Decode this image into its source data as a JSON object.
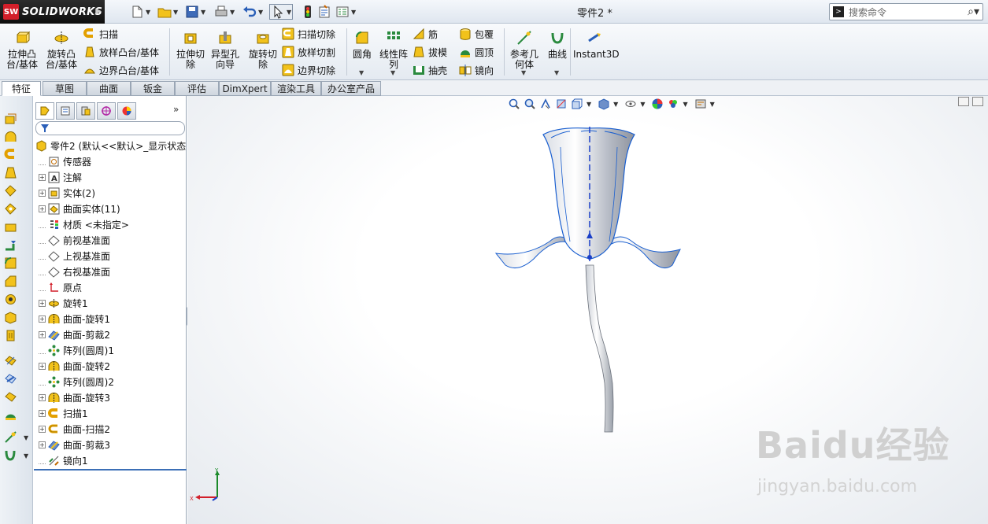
{
  "app": {
    "logo_text": "SOLIDWORKS",
    "logo_mark": "SW",
    "document_title": "零件2 *"
  },
  "search": {
    "placeholder": "搜索命令",
    "icon": "magnifier-icon"
  },
  "quick_access": [
    {
      "name": "new-icon"
    },
    {
      "name": "open-icon"
    },
    {
      "name": "save-icon"
    },
    {
      "name": "print-icon"
    },
    {
      "name": "undo-icon"
    },
    {
      "name": "select-icon"
    },
    {
      "name": "rebuild-icon"
    },
    {
      "name": "file-properties-icon"
    },
    {
      "name": "options-icon"
    }
  ],
  "command_manager": {
    "extrude_boss": "拉伸凸\n台/基体",
    "revolve_boss": "旋转凸\n台/基体",
    "sweep": "扫描",
    "loft_boss": "放样凸台/基体",
    "boundary_boss": "边界凸台/基体",
    "extrude_cut": "拉伸切\n除",
    "hole_wizard": "异型孔\n向导",
    "revolve_cut": "旋转切\n除",
    "swept_cut": "扫描切除",
    "lofted_cut": "放样切割",
    "boundary_cut": "边界切除",
    "fillet": "圆角",
    "linear_pattern": "线性阵\n列",
    "rib": "筋",
    "draft": "拔模",
    "shell": "抽壳",
    "wrap": "包覆",
    "dome": "圆顶",
    "mirror": "镜向",
    "ref_geometry": "参考几\n何体",
    "curves": "曲线",
    "instant3d": "Instant3D"
  },
  "tabs": [
    "特征",
    "草图",
    "曲面",
    "钣金",
    "评估",
    "DimXpert",
    "渲染工具",
    "办公室产品"
  ],
  "active_tab": "特征",
  "feature_tree": {
    "expand_glyph": "»",
    "root": "零件2  (默认<<默认>_显示状态",
    "items": [
      {
        "label": "传感器",
        "expandable": false,
        "icon": "sensor-icon"
      },
      {
        "label": "注解",
        "expandable": true,
        "icon": "annotation-icon"
      },
      {
        "label": "实体(2)",
        "expandable": true,
        "icon": "solid-bodies-icon"
      },
      {
        "label": "曲面实体(11)",
        "expandable": true,
        "icon": "surface-bodies-icon"
      },
      {
        "label": "材质 <未指定>",
        "expandable": false,
        "icon": "material-icon"
      },
      {
        "label": "前视基准面",
        "expandable": false,
        "icon": "plane-icon"
      },
      {
        "label": "上视基准面",
        "expandable": false,
        "icon": "plane-icon"
      },
      {
        "label": "右视基准面",
        "expandable": false,
        "icon": "plane-icon"
      },
      {
        "label": "原点",
        "expandable": false,
        "icon": "origin-icon"
      },
      {
        "label": "旋转1",
        "expandable": true,
        "icon": "revolve-icon"
      },
      {
        "label": "曲面-旋转1",
        "expandable": true,
        "icon": "surface-revolve-icon"
      },
      {
        "label": "曲面-剪裁2",
        "expandable": true,
        "icon": "surface-trim-icon"
      },
      {
        "label": "阵列(圆周)1",
        "expandable": false,
        "icon": "circular-pattern-icon"
      },
      {
        "label": "曲面-旋转2",
        "expandable": true,
        "icon": "surface-revolve-icon"
      },
      {
        "label": "阵列(圆周)2",
        "expandable": false,
        "icon": "circular-pattern-icon"
      },
      {
        "label": "曲面-旋转3",
        "expandable": true,
        "icon": "surface-revolve-icon"
      },
      {
        "label": "扫描1",
        "expandable": true,
        "icon": "sweep-icon"
      },
      {
        "label": "曲面-扫描2",
        "expandable": true,
        "icon": "surface-sweep-icon"
      },
      {
        "label": "曲面-剪裁3",
        "expandable": true,
        "icon": "surface-trim-icon"
      },
      {
        "label": "镜向1",
        "expandable": false,
        "icon": "mirror-icon"
      }
    ]
  },
  "triad": {
    "x_label": "X",
    "y_label": "Y"
  },
  "watermark": {
    "brand": "Baidu经验",
    "url": "jingyan.baidu.com"
  },
  "colors": {
    "accent": "#3b6fb6",
    "logo_red": "#d21f2a",
    "icon_yellow": "#f2c21b",
    "model_edge": "#1a5fd0"
  }
}
